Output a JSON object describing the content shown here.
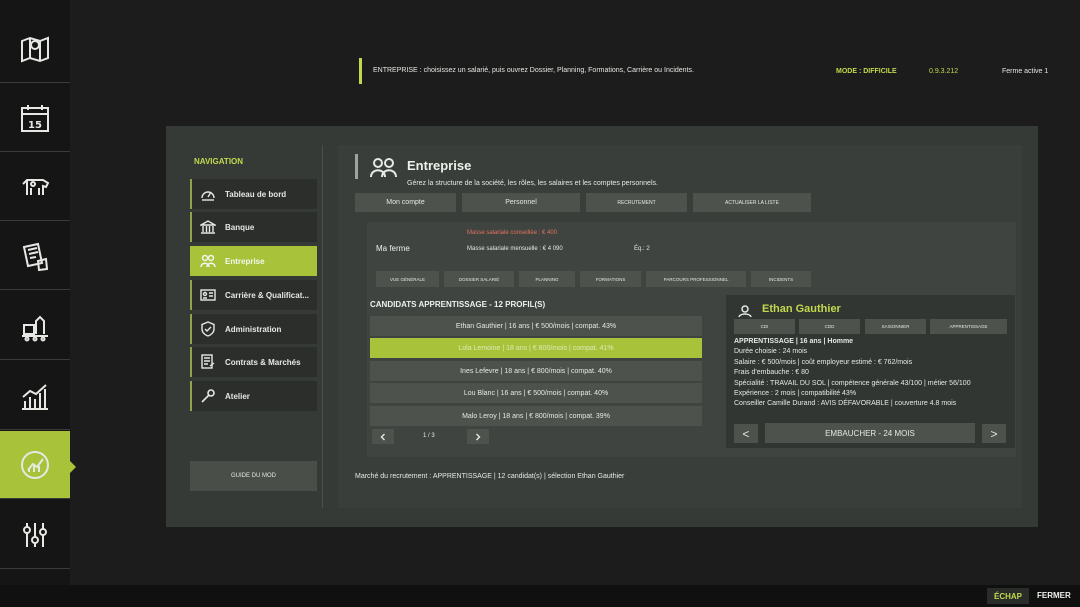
{
  "topbar": {
    "hint": "ENTREPRISE : choisissez un salarié, puis ouvrez Dossier, Planning, Formations, Carrière ou Incidents.",
    "mode": "MODE : DIFFICILE",
    "version": "0.9.3.212",
    "farm": "Ferme active 1"
  },
  "game_sidebar": {
    "items": [
      "map-icon",
      "calendar-icon",
      "animals-icon",
      "contracts-icon",
      "production-icon",
      "prices-icon",
      "mod-icon",
      "settings-icon"
    ],
    "calendar_day": "15",
    "active_index": 6,
    "accent": "#a8c33a"
  },
  "nav": {
    "heading": "NAVIGATION",
    "items": [
      {
        "label": "Tableau de bord",
        "icon": "gauge-icon"
      },
      {
        "label": "Banque",
        "icon": "bank-icon"
      },
      {
        "label": "Entreprise",
        "icon": "people-icon"
      },
      {
        "label": "Carrière & Qualificat...",
        "icon": "id-card-icon"
      },
      {
        "label": "Administration",
        "icon": "shield-icon"
      },
      {
        "label": "Contrats & Marchés",
        "icon": "document-icon"
      },
      {
        "label": "Atelier",
        "icon": "wrench-icon"
      }
    ],
    "active_index": 2,
    "guide_label": "GUIDE DU MOD"
  },
  "header": {
    "title": "Entreprise",
    "subtitle": "Gérez la structure de la société, les rôles, les salaires et les comptes personnels.",
    "tabs": [
      "Mon compte",
      "Personnel",
      "RECRUTEMENT",
      "ACTUALISER LA LISTE"
    ]
  },
  "info": {
    "warning": "Masse salariale conseillée : € 400",
    "farm": "Ma ferme",
    "payroll": "Masse salariale mensuelle : € 4 090",
    "team": "Éq.: 2",
    "subtabs": [
      "VUE GÉNÉRALE",
      "DOSSIER SALARIÉ",
      "PLANNING",
      "FORMATIONS",
      "PARCOURS PROFESSIONNEL",
      "INCIDENTS"
    ]
  },
  "candidates": {
    "heading": "CANDIDATS APPRENTISSAGE - 12 PROFIL(S)",
    "rows": [
      "Ethan Gauthier | 16 ans | € 500/mois | compat. 43%",
      "Lola Lemoine | 18 ans | € 800/mois | compat. 41%",
      "Ines Lefevre | 18 ans | € 800/mois | compat. 40%",
      "Lou Blanc | 16 ans | € 500/mois | compat. 40%",
      "Malo Leroy | 18 ans | € 800/mois | compat. 39%"
    ],
    "selected_index": 1,
    "page": "1 / 3"
  },
  "detail": {
    "name": "Ethan Gauthier",
    "tags": [
      "CDI",
      "CDD",
      "SAISONNIER",
      "APPRENTISSAGE"
    ],
    "lines": [
      "APPRENTISSAGE | 16 ans | Homme",
      "Durée choisie : 24 mois",
      "Salaire : € 500/mois | coût employeur estimé : € 762/mois",
      "Frais d'embauche : € 80",
      "Spécialité : TRAVAIL DU SOL | compétence générale 43/100 | métier 56/100",
      "Expérience : 2 mois | compatibilité 43%",
      "Conseiller Camille Durand : AVIS DÉFAVORABLE | couverture 4.8 mois"
    ],
    "prev": "<",
    "next": ">",
    "hire": "EMBAUCHER - 24 MOIS"
  },
  "market": "Marché du recrutement : APPRENTISSAGE | 12 candidat(s) | sélection Ethan Gauthier",
  "footer": {
    "esc": "ÉCHAP",
    "close": "FERMER"
  }
}
